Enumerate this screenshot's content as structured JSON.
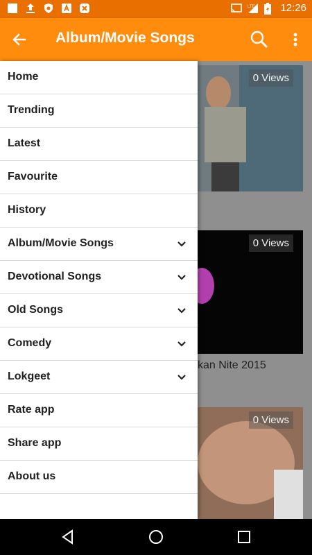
{
  "status_bar": {
    "time": "12:26",
    "network": "LTE"
  },
  "app_bar": {
    "title": "Album/Movie Songs"
  },
  "menu": {
    "items": [
      {
        "label": "Home",
        "expandable": false
      },
      {
        "label": "Trending",
        "expandable": false
      },
      {
        "label": "Latest",
        "expandable": false
      },
      {
        "label": "Favourite",
        "expandable": false
      },
      {
        "label": "History",
        "expandable": false
      },
      {
        "label": "Album/Movie Songs",
        "expandable": true
      },
      {
        "label": "Devotional Songs",
        "expandable": true
      },
      {
        "label": "Old Songs",
        "expandable": true
      },
      {
        "label": "Comedy",
        "expandable": true
      },
      {
        "label": "Lokgeet",
        "expandable": true
      },
      {
        "label": "Rate app",
        "expandable": false
      },
      {
        "label": "Share app",
        "expandable": false
      },
      {
        "label": "About us",
        "expandable": false
      }
    ]
  },
  "videos": [
    {
      "views": "0 Views",
      "title_fragment": ""
    },
    {
      "views": "0 Views",
      "title_fragment": "kan Nite 2015"
    },
    {
      "views": "0 Views",
      "title_fragment": ""
    }
  ],
  "colors": {
    "status_bar": "#e86f00",
    "app_bar": "#ff8c0d"
  },
  "icons": {
    "back": "arrow-left-icon",
    "search": "search-icon",
    "more": "more-vert-icon",
    "chevron": "chevron-down-icon"
  }
}
